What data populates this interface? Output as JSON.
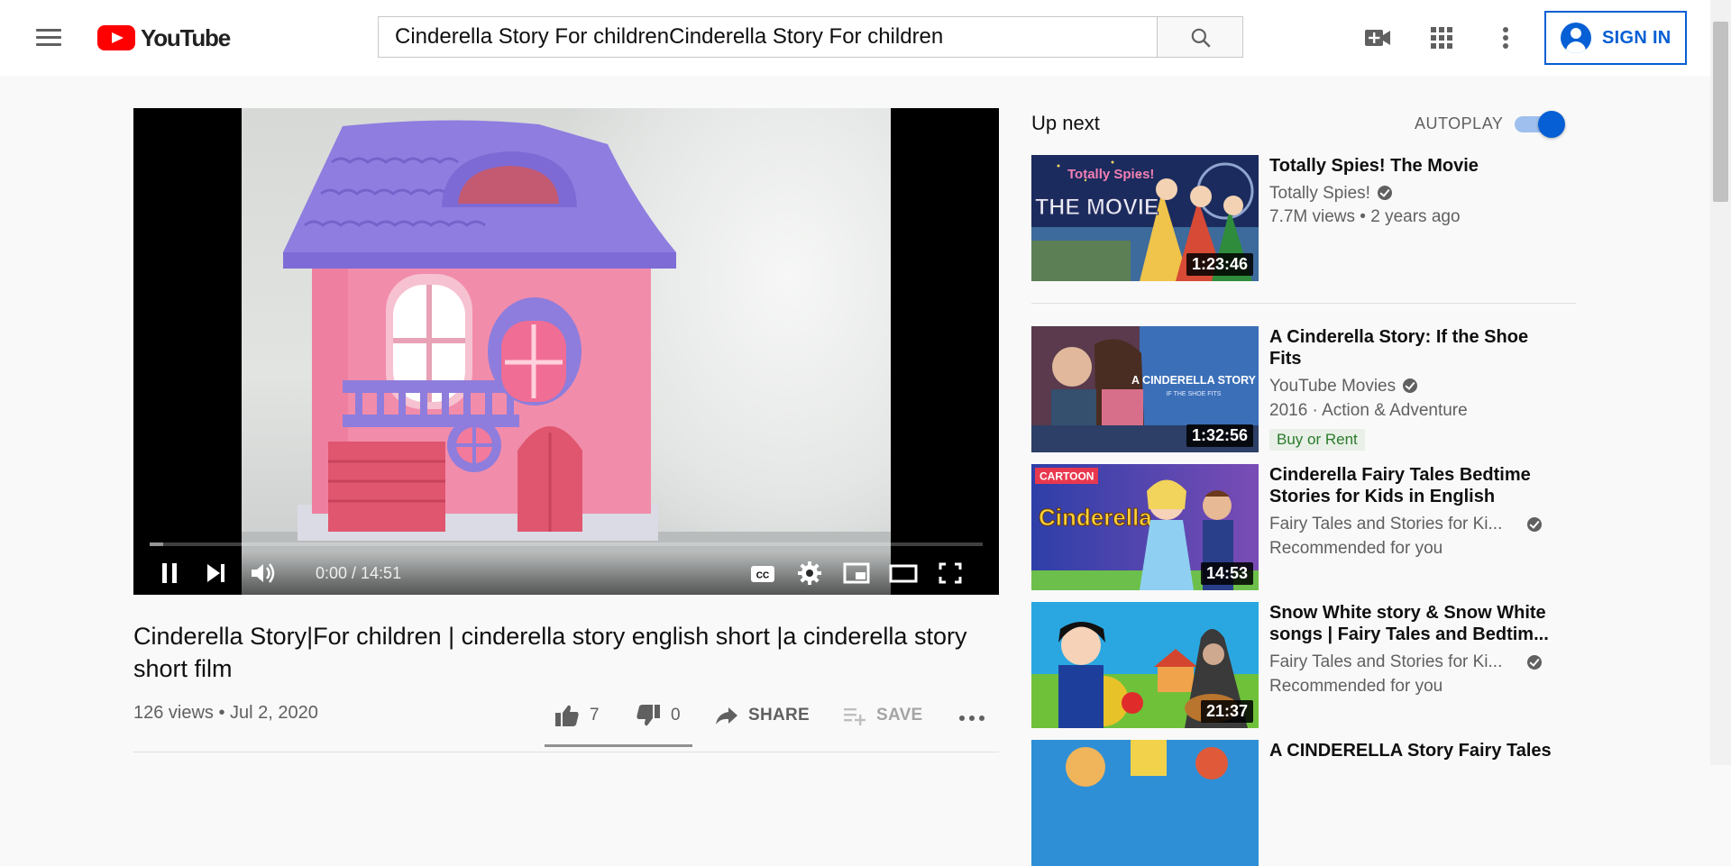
{
  "header": {
    "logo_text": "YouTube",
    "search_value": "Cinderella Story For childrenCinderella Story For children",
    "sign_in_label": "SIGN IN"
  },
  "player": {
    "time": "0:00 / 14:51",
    "progress_fraction": 0.0,
    "buffered_fraction": 0.016
  },
  "video": {
    "title": "Cinderella Story|For children | cinderella story english short |a cinderella story short film",
    "views_date": "126 views • Jul 2, 2020",
    "likes": "7",
    "dislikes": "0",
    "share_label": "SHARE",
    "save_label": "SAVE"
  },
  "secondary": {
    "up_next": "Up next",
    "autoplay": "AUTOPLAY",
    "autoplay_on": true
  },
  "recommendations": [
    {
      "title": "Totally Spies! The Movie",
      "channel": "Totally Spies!",
      "line2": "7.7M views • 2 years ago",
      "duration": "1:23:46",
      "verified": true
    },
    {
      "title": "A Cinderella Story: If the Shoe Fits",
      "channel": "YouTube Movies",
      "line2": "2016 · Action & Adventure",
      "badge": "Buy or Rent",
      "duration": "1:32:56",
      "verified": true
    },
    {
      "title": "Cinderella Fairy Tales Bedtime Stories for Kids in English",
      "channel": "Fairy Tales and Stories for Ki...",
      "line2": "Recommended for you",
      "duration": "14:53",
      "thumb_badge": "CARTOON",
      "thumb_text": "Cinderella",
      "verified": true
    },
    {
      "title": "Snow White story & Snow White songs | Fairy Tales and Bedtim...",
      "channel": "Fairy Tales and Stories for Ki...",
      "line2": "Recommended for you",
      "duration": "21:37",
      "verified": true
    },
    {
      "title": "A CINDERELLA Story Fairy Tales"
    }
  ],
  "thumb_texts": {
    "spies_logo": "Totally Spies!",
    "spies_movie": "THE MOVIE",
    "cinderella_story": "A CINDERELLA STORY",
    "shoe_fits": "IF THE SHOE FITS"
  },
  "colors": {
    "accent": "#065fd4",
    "brand_red": "#ff0000"
  }
}
